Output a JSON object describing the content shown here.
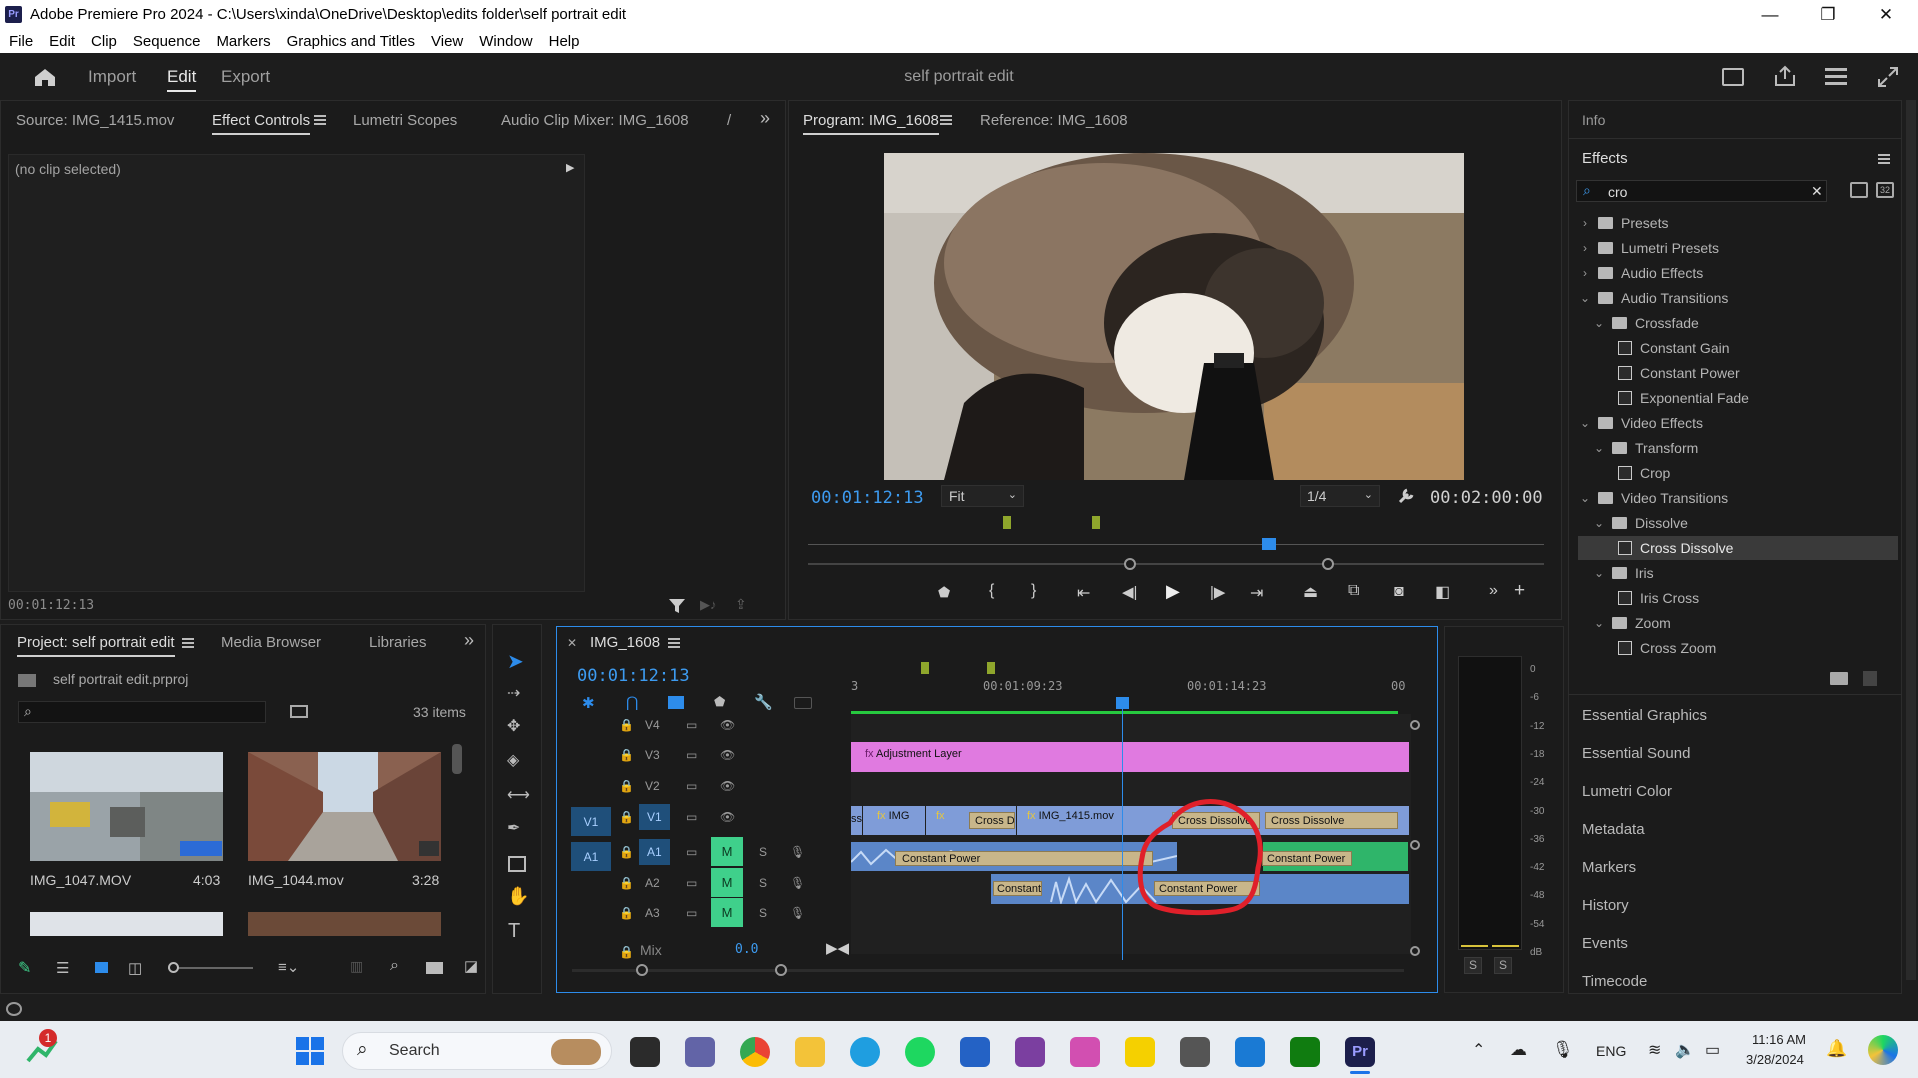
{
  "titlebar": {
    "app_badge": "Pr",
    "title": "Adobe Premiere Pro 2024 - C:\\Users\\xinda\\OneDrive\\Desktop\\edits folder\\self portrait edit",
    "minimize": "—",
    "restore": "❐",
    "close": "✕"
  },
  "menu": [
    "File",
    "Edit",
    "Clip",
    "Sequence",
    "Markers",
    "Graphics and Titles",
    "View",
    "Window",
    "Help"
  ],
  "workspace": {
    "tabs": [
      "Import",
      "Edit",
      "Export"
    ],
    "active_tab": "Edit",
    "project_title": "self portrait edit"
  },
  "source_panel": {
    "tabs": [
      "Source: IMG_1415.mov",
      "Effect Controls",
      "Lumetri Scopes",
      "Audio Clip Mixer: IMG_1608",
      "/"
    ],
    "no_clip": "(no clip selected)",
    "timecode": "00:01:12:13"
  },
  "program_panel": {
    "tab": "Program: IMG_1608",
    "reference_tab": "Reference: IMG_1608",
    "timecode": "00:01:12:13",
    "fit": "Fit",
    "resolution": "1/4",
    "duration": "00:02:00:00"
  },
  "right_panel": {
    "info": "Info",
    "effects_title": "Effects",
    "search_value": "cro",
    "tree": [
      {
        "label": "Presets",
        "type": "folder",
        "level": 0,
        "expanded": false
      },
      {
        "label": "Lumetri Presets",
        "type": "folder",
        "level": 0,
        "expanded": false
      },
      {
        "label": "Audio Effects",
        "type": "folder",
        "level": 0,
        "expanded": false
      },
      {
        "label": "Audio Transitions",
        "type": "folder",
        "level": 0,
        "expanded": true
      },
      {
        "label": "Crossfade",
        "type": "folder",
        "level": 1,
        "expanded": true
      },
      {
        "label": "Constant Gain",
        "type": "effect",
        "level": 2
      },
      {
        "label": "Constant Power",
        "type": "effect",
        "level": 2
      },
      {
        "label": "Exponential Fade",
        "type": "effect",
        "level": 2
      },
      {
        "label": "Video Effects",
        "type": "folder",
        "level": 0,
        "expanded": true
      },
      {
        "label": "Transform",
        "type": "folder",
        "level": 1,
        "expanded": true
      },
      {
        "label": "Crop",
        "type": "effect",
        "level": 2
      },
      {
        "label": "Video Transitions",
        "type": "folder",
        "level": 0,
        "expanded": true
      },
      {
        "label": "Dissolve",
        "type": "folder",
        "level": 1,
        "expanded": true
      },
      {
        "label": "Cross Dissolve",
        "type": "effect",
        "level": 2,
        "selected": true
      },
      {
        "label": "Iris",
        "type": "folder",
        "level": 1,
        "expanded": true
      },
      {
        "label": "Iris Cross",
        "type": "effect",
        "level": 2
      },
      {
        "label": "Zoom",
        "type": "folder",
        "level": 1,
        "expanded": true
      },
      {
        "label": "Cross Zoom",
        "type": "effect",
        "level": 2
      }
    ],
    "side_items": [
      "Essential Graphics",
      "Essential Sound",
      "Lumetri Color",
      "Metadata",
      "Markers",
      "History",
      "Events",
      "Timecode"
    ]
  },
  "project_panel": {
    "tabs": [
      "Project: self portrait edit",
      "Media Browser",
      "Libraries"
    ],
    "file": "self portrait edit.prproj",
    "count": "33 items",
    "media": [
      {
        "name": "IMG_1047.MOV",
        "duration": "4:03"
      },
      {
        "name": "IMG_1044.mov",
        "duration": "3:28"
      }
    ]
  },
  "timeline": {
    "tab": "IMG_1608",
    "timecode": "00:01:12:13",
    "ruler": [
      "3",
      "00:01:09:23",
      "00:01:14:23",
      "00"
    ],
    "tracks": [
      "V4",
      "V3",
      "V2",
      "V1",
      "A1",
      "A2",
      "A3"
    ],
    "src_v1": "V1",
    "src_a1": "A1",
    "mix_label": "Mix",
    "mix_value": "0.0",
    "clips": {
      "adjustment": "Adjustment Layer",
      "v1_a": "ss",
      "v1_b": "IMG",
      "v1_c": "Cross D",
      "v1_d": "IMG_1415.mov",
      "v1_e": "Cross Dissolve",
      "v1_f": "Cross Dissolve",
      "a1_a": "Constant Power",
      "a1_b": "Constant Power",
      "a2_a": "Constant",
      "a2_b": "Constant Power"
    },
    "m": "M",
    "s": "S"
  },
  "meter": {
    "scale": [
      "0",
      "-6",
      "-12",
      "-18",
      "-24",
      "-30",
      "-36",
      "-42",
      "-48",
      "-54",
      "dB"
    ],
    "solo": [
      "S",
      "S"
    ]
  },
  "taskbar": {
    "search": "Search",
    "lang": "ENG",
    "time": "11:16 AM",
    "date": "3/28/2024",
    "badge": "1"
  },
  "colors": {
    "accent_blue": "#2d8ceb",
    "adjustment_layer": "#e07ae0",
    "video_clip": "#7f9cd8",
    "audio_clip": "#5b86c8",
    "transition": "#c8b68a",
    "annotation": "#e0202a",
    "m_button": "#3fd08b"
  }
}
